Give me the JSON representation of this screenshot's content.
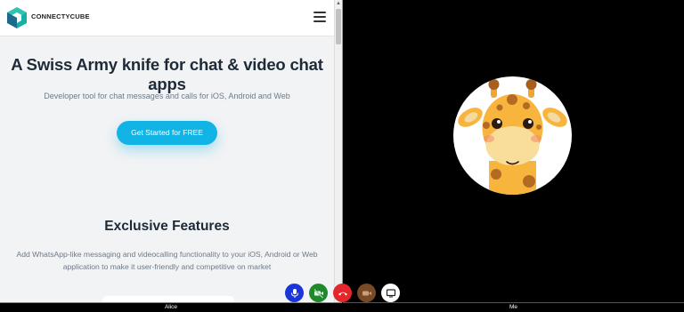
{
  "browser": {
    "brand": "CONNECTYCUBE",
    "hero": {
      "title": "A Swiss Army knife for chat & video chat apps",
      "subtitle": "Developer tool for chat messages and calls for iOS, Android and Web",
      "cta": "Get Started for FREE"
    },
    "features": {
      "title": "Exclusive Features",
      "description": "Add WhatsApp-like messaging and videocalling functionality to your iOS, Android or Web application to make it user-friendly and competitive on market"
    }
  },
  "call": {
    "participants": {
      "left": "Alice",
      "right": "Me"
    },
    "controls": [
      {
        "name": "microphone",
        "color": "#1a36d8"
      },
      {
        "name": "video-off",
        "color": "#1e8a2c"
      },
      {
        "name": "end-call",
        "color": "#e5262a"
      },
      {
        "name": "camera-switch",
        "color": "#7a4a26"
      },
      {
        "name": "screen-share",
        "color": "#ffffff"
      }
    ]
  },
  "colors": {
    "accent": "#12b4e6",
    "background": "#000000",
    "logo_primary": "#18b0a4",
    "logo_secondary": "#1d6b8c"
  }
}
